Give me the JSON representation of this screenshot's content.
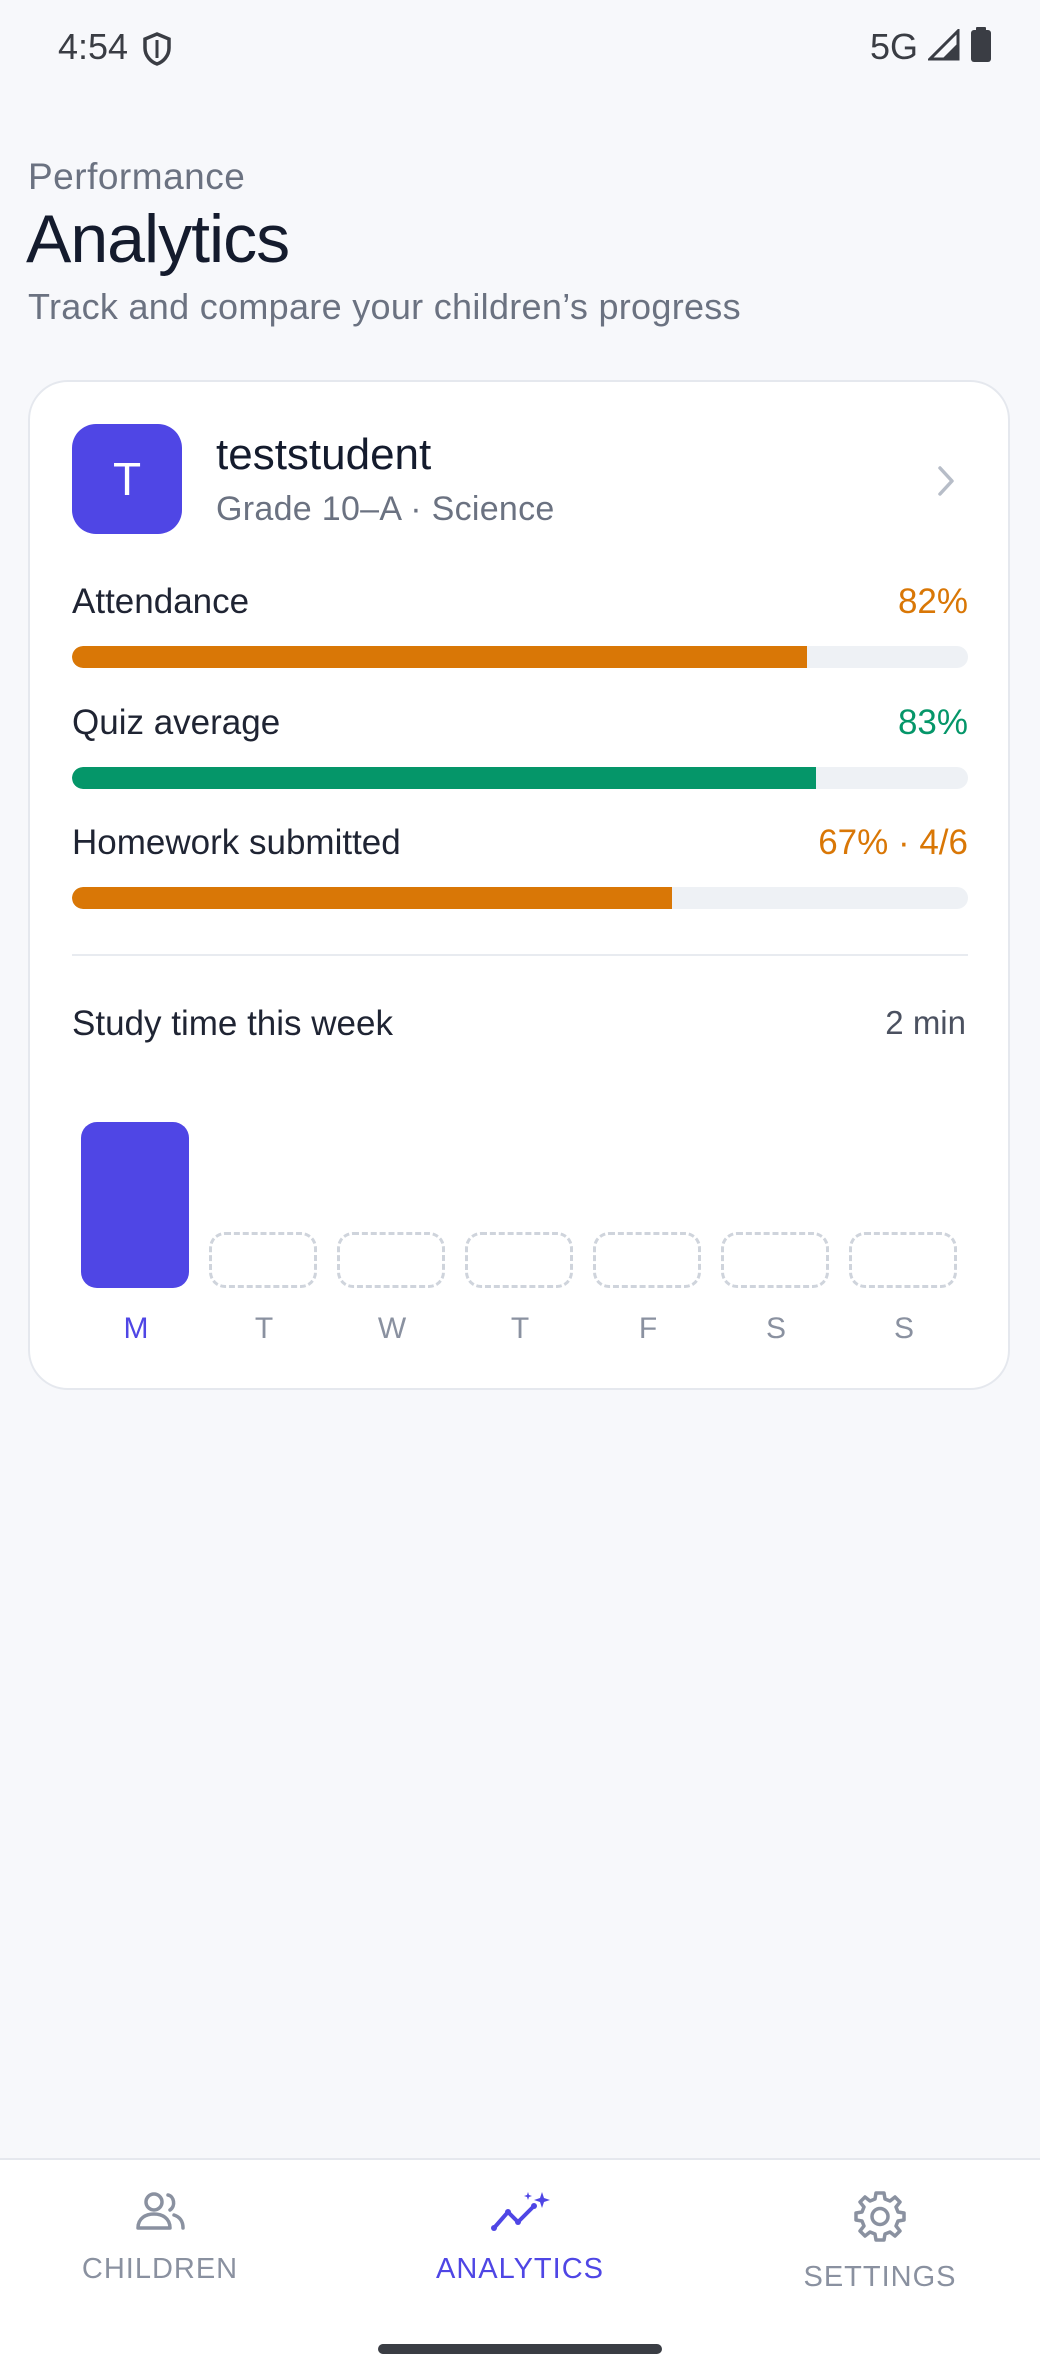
{
  "status": {
    "time": "4:54",
    "network": "5G",
    "icons": [
      "shield-icon",
      "signal-icon",
      "battery-icon"
    ]
  },
  "header": {
    "eyebrow": "Performance",
    "title": "Analytics",
    "subtitle": "Track and compare your children’s progress"
  },
  "student": {
    "initial": "T",
    "name": "teststudent",
    "meta": "Grade 10–A · Science",
    "accent": "#4f46e5",
    "metrics": [
      {
        "label": "Attendance",
        "value": "82%",
        "level": 0.82,
        "color": "#d97706"
      },
      {
        "label": "Quiz average",
        "value": "83%",
        "level": 0.83,
        "color": "#059669"
      },
      {
        "label": "Homework submitted",
        "value": "67% · 4/6",
        "level": 0.67,
        "color": "#d97706"
      }
    ],
    "study": {
      "title": "Study time this week",
      "total": "2 min",
      "days": [
        {
          "label": "M",
          "minutes": 2,
          "active": true
        },
        {
          "label": "T",
          "minutes": 0,
          "active": false
        },
        {
          "label": "W",
          "minutes": 0,
          "active": false
        },
        {
          "label": "T",
          "minutes": 0,
          "active": false
        },
        {
          "label": "F",
          "minutes": 0,
          "active": false
        },
        {
          "label": "S",
          "minutes": 0,
          "active": false
        },
        {
          "label": "S",
          "minutes": 0,
          "active": false
        }
      ]
    }
  },
  "nav": {
    "items": [
      {
        "label": "CHILDREN",
        "icon": "children-icon",
        "active": false
      },
      {
        "label": "ANALYTICS",
        "icon": "analytics-icon",
        "active": true
      },
      {
        "label": "SETTINGS",
        "icon": "settings-icon",
        "active": false
      }
    ]
  }
}
